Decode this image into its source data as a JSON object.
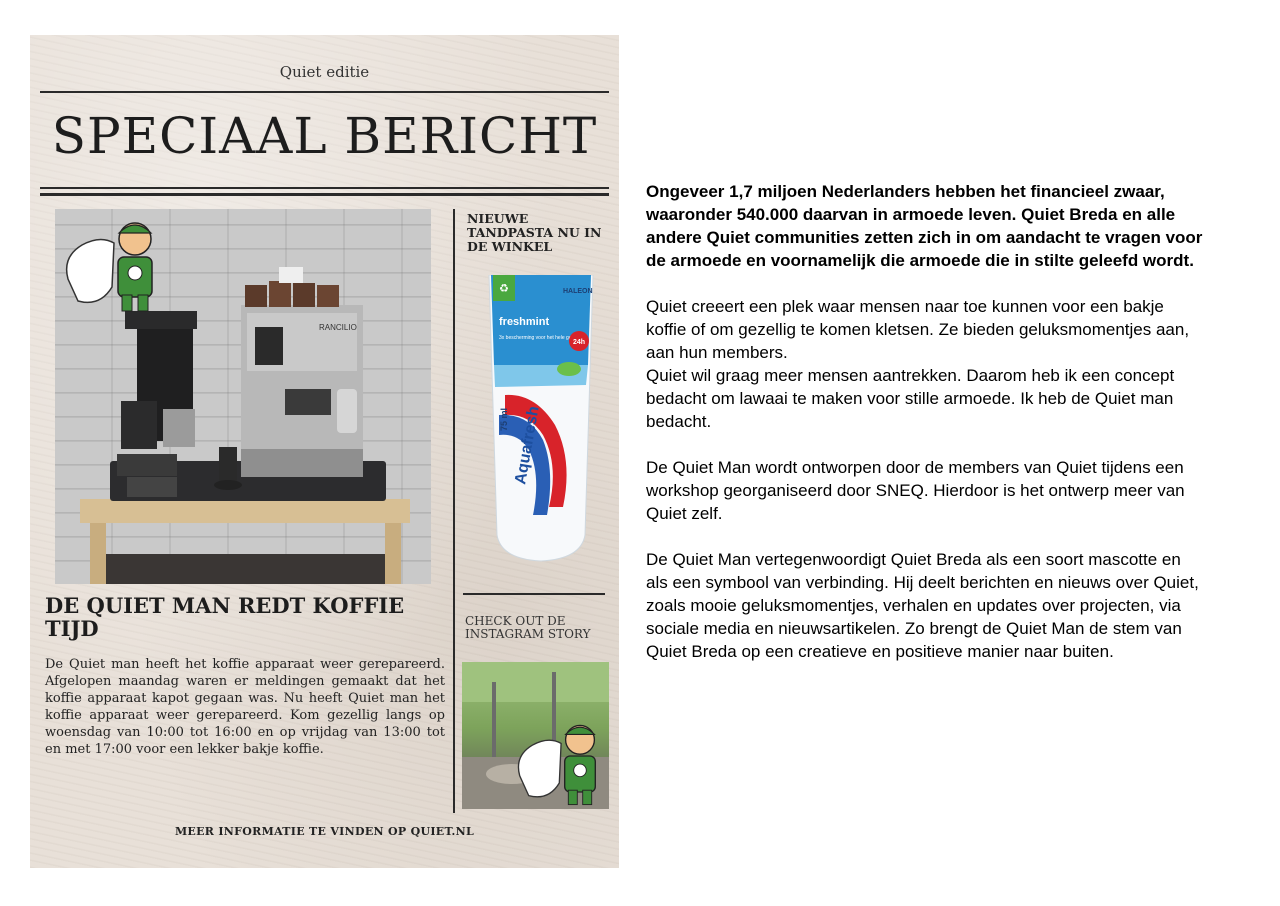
{
  "newspaper": {
    "edition": "Quiet editie",
    "headline": "SPECIAAL BERICHT",
    "sidebar_heading": "NIEUWE TANDPASTA NU IN DE WINKEL",
    "product": {
      "brand": "Aquafresh",
      "variant": "freshmint",
      "maker": "HALEON",
      "volume": "75 ml",
      "claim": "3x bescherming voor het hele gezin",
      "badge": "24h"
    },
    "sidebar_sub": "CHECK OUT DE INSTAGRAM STORY",
    "story_title": "DE QUIET MAN REDT KOFFIE TIJD",
    "story_body": "De Quiet man heeft het koffie apparaat weer gerepareerd. Afgelopen maandag waren er meldingen gemaakt dat het koffie apparaat kapot gegaan was. Nu heeft Quiet man het koffie apparaat weer gerepareerd. Kom gezellig langs op woensdag van 10:00 tot 16:00 en op vrijdag van 13:00 tot en met 17:00 voor een lekker bakje koffie.",
    "machine_brand": "RANCILIO",
    "footer": "MEER INFORMATIE TE VINDEN OP QUIET.NL"
  },
  "article": {
    "lead": "Ongeveer 1,7 miljoen Nederlanders hebben het financieel zwaar, waaronder 540.000 daarvan in armoede leven. Quiet Breda en alle andere Quiet communities zetten zich in om aandacht te vragen voor de armoede en voornamelijk die armoede die in stilte geleefd wordt.",
    "p2a": "Quiet creeert een plek waar mensen naar toe kunnen voor een bakje koffie of om gezellig te komen kletsen. Ze bieden geluksmomentjes aan, aan hun members.",
    "p2b": "Quiet wil graag meer mensen aantrekken. Daarom heb ik een concept bedacht om lawaai te maken voor stille armoede. Ik heb de Quiet man bedacht.",
    "p3": "De Quiet Man wordt ontworpen door de members van Quiet tijdens een workshop georganiseerd door SNEQ. Hierdoor is het ontwerp meer van Quiet zelf.",
    "p4": "De Quiet Man vertegenwoordigt Quiet Breda als een soort mascotte en als een symbool van verbinding. Hij deelt berichten en nieuws over Quiet,  zoals mooie geluksmomentjes, verhalen en updates over projecten, via sociale media en nieuwsartikelen. Zo brengt de Quiet Man de stem van Quiet Breda op een creatieve en positieve manier naar buiten."
  },
  "colors": {
    "paper_bg": "#e8e0d8",
    "ink": "#1d1d1d",
    "hero_green": "#3f8f3a",
    "tube_blue": "#2a8fd0",
    "tube_red": "#d8232a"
  },
  "icons": [
    "quiet-man-mascot-icon",
    "recycle-icon",
    "mint-leaf-icon"
  ]
}
